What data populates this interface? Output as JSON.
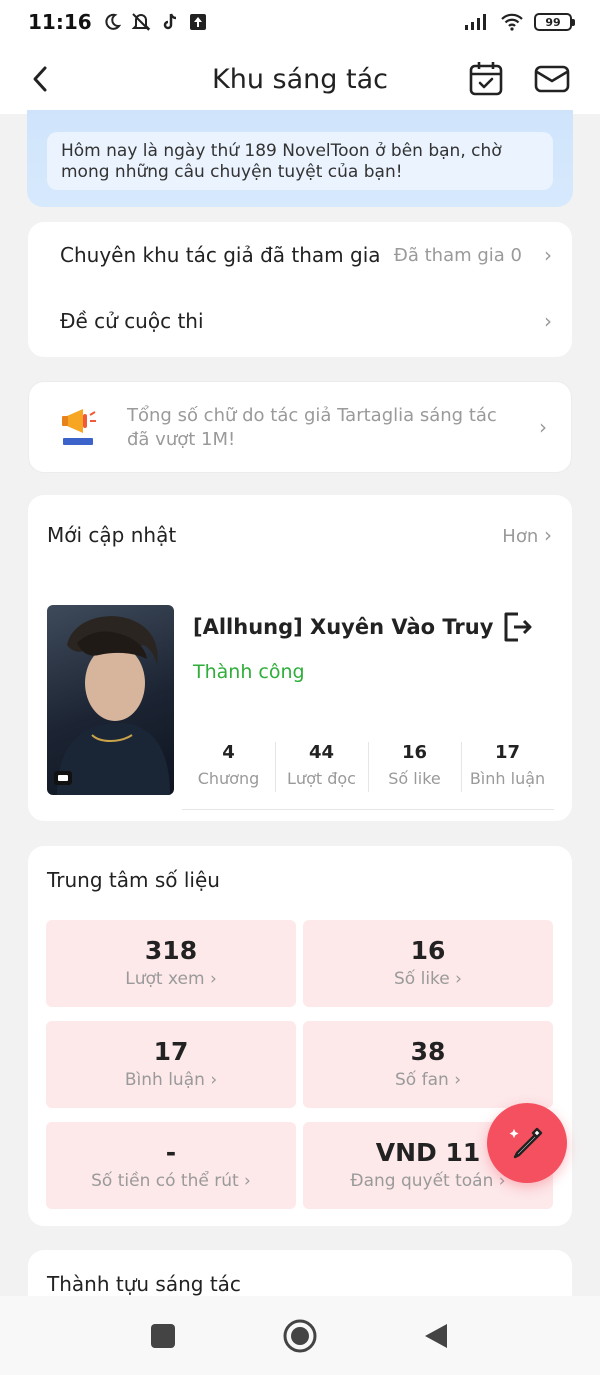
{
  "status_bar": {
    "time": "11:16",
    "battery": "99"
  },
  "header": {
    "title": "Khu sáng tác"
  },
  "banner": {
    "message": "Hôm nay là ngày thứ 189 NovelToon ở bên bạn, chờ mong những câu chuyện tuyệt của bạn!"
  },
  "links": {
    "joined_zone_label": "Chuyên khu tác giả đã tham gia",
    "joined_zone_value": "Đã tham gia 0",
    "contest_label": "Đề cử cuộc thi"
  },
  "notice": {
    "text": "Tổng số chữ do tác giả Tartaglia sáng tác đã vượt 1M!"
  },
  "recent": {
    "title": "Mới cập nhật",
    "more": "Hơn",
    "book_title": "[Allhung] Xuyên Vào Truyệ...",
    "book_status": "Thành công",
    "stats": [
      {
        "value": "4",
        "label": "Chương"
      },
      {
        "value": "44",
        "label": "Lượt đọc"
      },
      {
        "value": "16",
        "label": "Số like"
      },
      {
        "value": "17",
        "label": "Bình luận"
      }
    ]
  },
  "data_center": {
    "title": "Trung tâm số liệu",
    "tiles": [
      {
        "value": "318",
        "label": "Lượt xem"
      },
      {
        "value": "16",
        "label": "Số like"
      },
      {
        "value": "17",
        "label": "Bình luận"
      },
      {
        "value": "38",
        "label": "Số fan"
      },
      {
        "value": "-",
        "label": "Số tiền có thể rút"
      },
      {
        "value": "VND 11",
        "label": "Đang quyết toán"
      }
    ]
  },
  "achievements": {
    "title": "Thành tựu sáng tác"
  },
  "colors": {
    "accent": "#f4505f",
    "success": "#2fae3a",
    "tile_bg": "#fde8ea",
    "banner_bg": "#d7e9fd"
  }
}
